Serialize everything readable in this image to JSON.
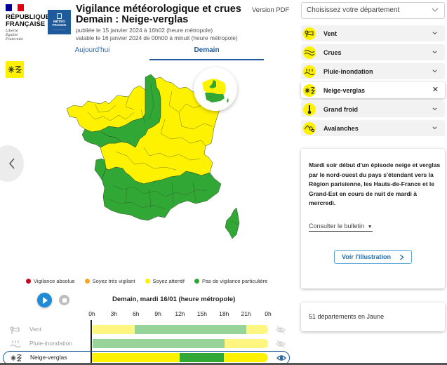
{
  "header": {
    "republic_line1": "RÉPUBLIQUE",
    "republic_line2": "FRANÇAISE",
    "motto": [
      "Liberté",
      "Égalité",
      "Fraternité"
    ],
    "meteo_logo_line1": "MÉTÉO",
    "meteo_logo_line2": "FRANCE",
    "title_line1": "Vigilance météorologique et crues",
    "title_line2": "Demain : Neige-verglas",
    "published": "publiée le 15 janvier 2024 à 16h02 (heure métropole)",
    "valid": "valable le 16 janvier 2024 de 00h00 à minuit (heure métropole)",
    "pdf_link": "Version PDF"
  },
  "tabs": [
    {
      "label": "Aujourd'hui",
      "active": false
    },
    {
      "label": "Demain",
      "active": true
    }
  ],
  "current_phenomenon": {
    "icon": "snow-ice-icon",
    "color": "#fff200"
  },
  "map": {
    "colors": {
      "yellow": "#fff200",
      "green": "#31a836",
      "border": "#2e4a1f"
    },
    "yellow_departments_count": 51
  },
  "legend": [
    {
      "label": "Vigilance absolue",
      "color": "#d0021b"
    },
    {
      "label": "Soyez très vigilant",
      "color": "#f5a623"
    },
    {
      "label": "Soyez attentif",
      "color": "#fff200"
    },
    {
      "label": "Pas de vigilance particulière",
      "color": "#31a836"
    }
  ],
  "playback": {
    "date_label": "Demain, mardi 16/01 (heure métropole)"
  },
  "timeline": {
    "hours": [
      "0h",
      "3h",
      "6h",
      "9h",
      "12h",
      "15h",
      "18h",
      "21h",
      "0h"
    ],
    "rows": [
      {
        "label": "Vent",
        "icon": "wind-icon",
        "selected": false,
        "visible": false,
        "segments": [
          {
            "from": 0,
            "to": 5.8,
            "level": "yellow"
          },
          {
            "from": 5.8,
            "to": 21,
            "level": "green"
          },
          {
            "from": 21,
            "to": 24,
            "level": "yellow"
          }
        ]
      },
      {
        "label": "Pluie-inondation",
        "icon": "rain-flood-icon",
        "selected": false,
        "visible": false,
        "segments": [
          {
            "from": 0,
            "to": 18,
            "level": "green"
          },
          {
            "from": 18,
            "to": 24,
            "level": "yellow"
          }
        ]
      },
      {
        "label": "Neige-verglas",
        "icon": "snow-ice-icon",
        "selected": true,
        "visible": true,
        "segments": [
          {
            "from": 0,
            "to": 12,
            "level": "yellow"
          },
          {
            "from": 12,
            "to": 18,
            "level": "green"
          },
          {
            "from": 18,
            "to": 24,
            "level": "yellow"
          }
        ]
      }
    ],
    "colors": {
      "yellow": "#fff200",
      "green": "#31a836",
      "yellow_dim": "#fff682",
      "green_dim": "#98d49a"
    }
  },
  "sidebar": {
    "department_select": {
      "placeholder": "Choisissez votre département"
    },
    "phenomena": [
      {
        "label": "Vent",
        "icon": "wind-icon",
        "active": false
      },
      {
        "label": "Crues",
        "icon": "flood-icon",
        "active": false
      },
      {
        "label": "Pluie-inondation",
        "icon": "rain-flood-icon",
        "active": false
      },
      {
        "label": "Neige-verglas",
        "icon": "snow-ice-icon",
        "active": true
      },
      {
        "label": "Grand froid",
        "icon": "thermometer-icon",
        "active": false
      },
      {
        "label": "Avalanches",
        "icon": "avalanche-icon",
        "active": false
      }
    ],
    "info": {
      "text": "Mardi soir début d'un épisode neige et verglas par le nord-ouest du pays s'étendant vers la Région parisienne, les Hauts-de-France et le Grand-Est en cours de nuit de mardi à mercredi.",
      "bulletin_link": "Consulter le bulletin",
      "illustration_button": "Voir l'illustration"
    },
    "count_text": "51 départements en Jaune"
  }
}
